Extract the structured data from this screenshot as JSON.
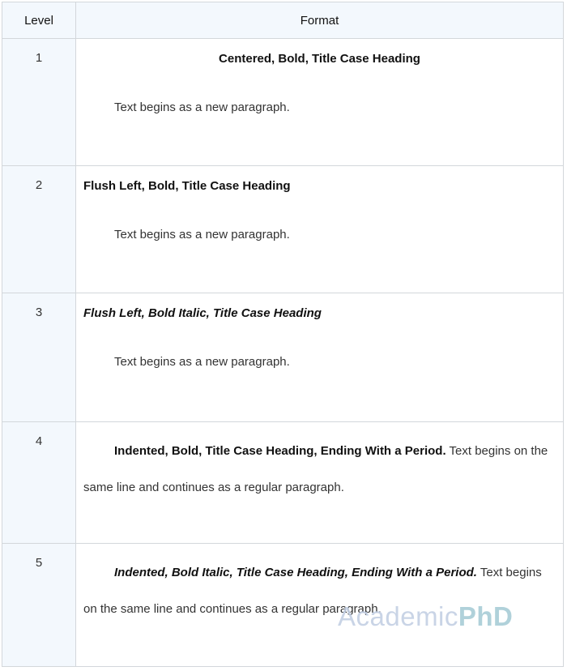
{
  "table": {
    "headers": {
      "level": "Level",
      "format": "Format"
    },
    "rows": [
      {
        "level": "1",
        "heading": "Centered, Bold, Title Case Heading",
        "paragraph": "Text begins as a new paragraph."
      },
      {
        "level": "2",
        "heading": "Flush Left, Bold, Title Case Heading",
        "paragraph": "Text begins as a new paragraph."
      },
      {
        "level": "3",
        "heading": "Flush Left, Bold Italic, Title Case Heading",
        "paragraph": "Text begins as a new paragraph."
      },
      {
        "level": "4",
        "heading": "Indented, Bold, Title Case Heading, Ending With a Period.",
        "paragraph": " Text begins on the same line and continues as a regular paragraph."
      },
      {
        "level": "5",
        "heading": "Indented, Bold Italic, Title Case Heading, Ending With a Period.",
        "paragraph": " Text begins on the same line and continues as a regular paragraph."
      }
    ]
  },
  "watermark": {
    "part1": "Academic",
    "part2": "PhD"
  }
}
